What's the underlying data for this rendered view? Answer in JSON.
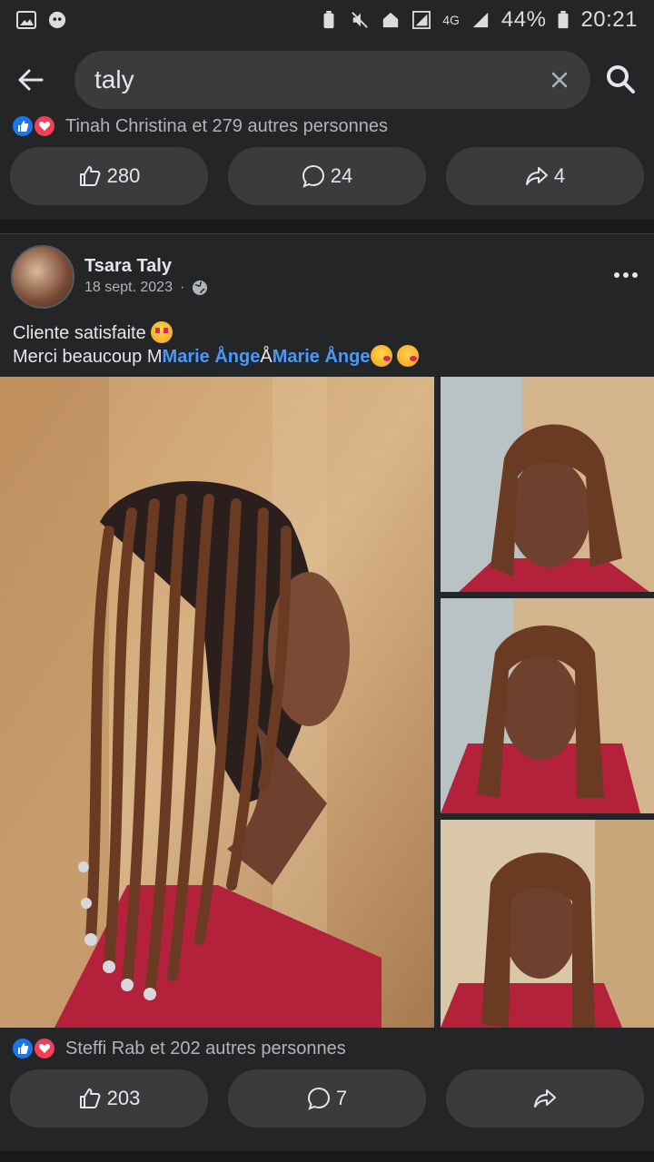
{
  "status_bar": {
    "battery_percent": "44%",
    "time": "20:21",
    "network": "4G"
  },
  "search": {
    "query": "taly"
  },
  "previous_post": {
    "reactions_text": "Tinah Christina et 279 autres personnes",
    "likes": "280",
    "comments": "24",
    "shares": "4"
  },
  "post": {
    "author": "Tsara Taly",
    "date": "18 sept. 2023",
    "separator": "·",
    "text_line1": "Cliente satisfaite",
    "text_line2_prefix": "Merci beaucoup M",
    "mention1": "Marie Ånge",
    "text_between": "Å",
    "mention2": "Marie Ånge",
    "reactions_text": "Steffi Rab et 202 autres personnes",
    "likes": "203",
    "comments": "7"
  },
  "colors": {
    "background": "#18191a",
    "card": "#242526",
    "button": "#3a3b3c",
    "mention": "#4599ff",
    "like_blue": "#1877f2",
    "love_red": "#f33e58"
  },
  "icons": {
    "back": "arrow-left-icon",
    "clear": "close-icon",
    "search": "search-icon",
    "like": "thumbs-up-icon",
    "comment": "comment-bubble-icon",
    "share": "share-arrow-icon",
    "more": "more-horizontal-icon",
    "privacy": "globe-icon"
  }
}
